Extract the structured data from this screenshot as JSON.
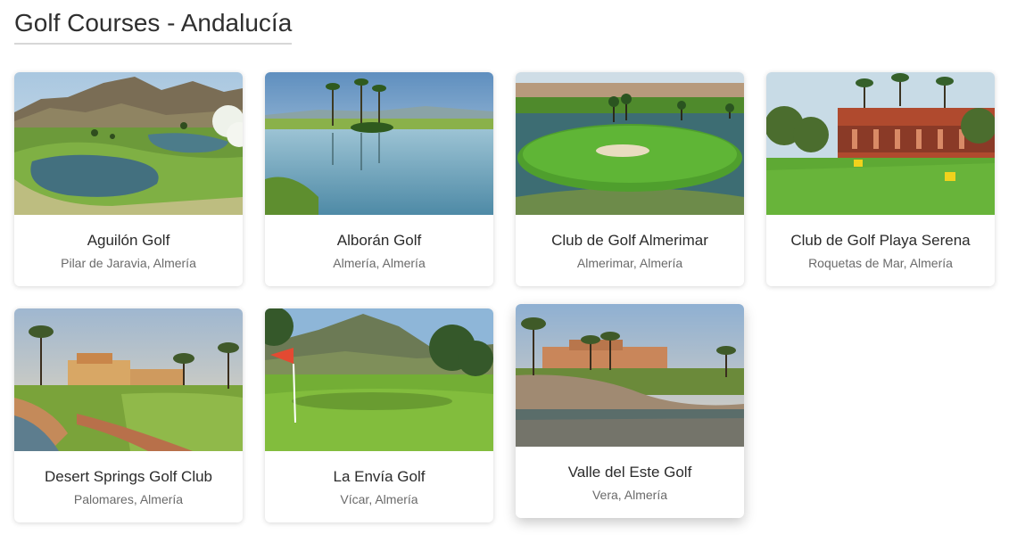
{
  "page": {
    "title": "Golf Courses - Andalucía"
  },
  "courses": [
    {
      "name": "Aguilón Golf",
      "location": "Pilar de Jaravia, Almería",
      "image": "mountain-course-with-lake"
    },
    {
      "name": "Alborán Golf",
      "location": "Almería, Almería",
      "image": "palm-trees-reflected-in-lake"
    },
    {
      "name": "Club de Golf Almerimar",
      "location": "Almerimar, Almería",
      "image": "island-green-with-bunker"
    },
    {
      "name": "Club de Golf Playa Serena",
      "location": "Roquetas de Mar, Almería",
      "image": "clubhouse-with-yellow-flags"
    },
    {
      "name": "Desert Springs Golf Club",
      "location": "Palomares, Almería",
      "image": "clubhouse-at-sunset-with-creek"
    },
    {
      "name": "La Envía Golf",
      "location": "Vícar, Almería",
      "image": "green-with-red-flag-and-mountains"
    },
    {
      "name": "Valle del Este Golf",
      "location": "Vera, Almería",
      "image": "hotel-reflected-in-lake"
    }
  ],
  "colors": {
    "sky": "#bcd6ea",
    "grass": "#5da332",
    "water": "#6fa3bd",
    "card_shadow": "#00000029"
  }
}
